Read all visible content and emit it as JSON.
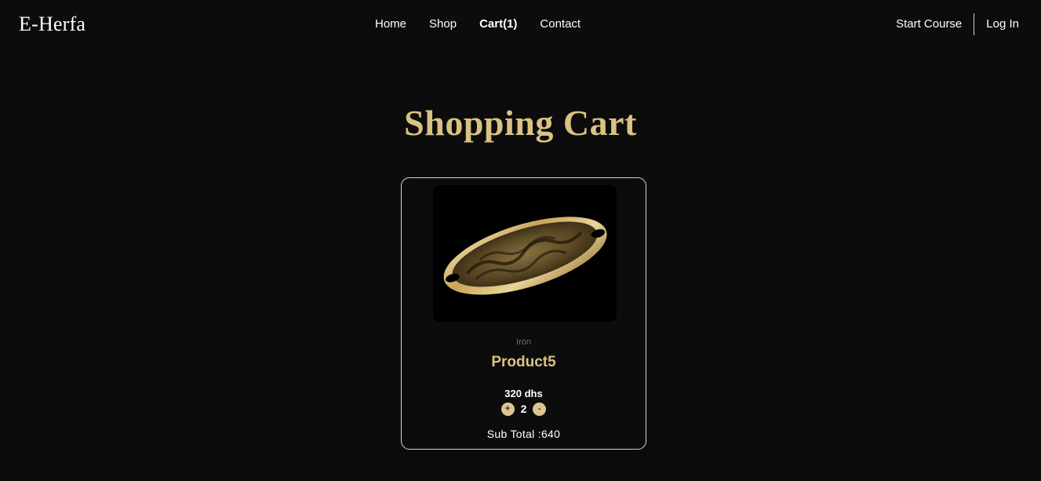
{
  "brand": {
    "logo": "E-Herfa"
  },
  "nav": {
    "links": [
      {
        "label": "Home",
        "active": false
      },
      {
        "label": "Shop",
        "active": false
      },
      {
        "label": "Cart(1)",
        "active": true
      },
      {
        "label": "Contact",
        "active": false
      }
    ],
    "start_course": "Start Course",
    "login": "Log In"
  },
  "page": {
    "title": "Shopping Cart"
  },
  "cart": {
    "item": {
      "image_desc": "product5-tray-image",
      "category": "Iron",
      "name": "Product5",
      "price": "320 dhs",
      "quantity": "2",
      "increment_label": "+",
      "decrement_label": "-",
      "subtotal": "Sub Total :640"
    }
  },
  "colors": {
    "background": "#0c0c0c",
    "accent_gold": "#d9c282",
    "qty_button": "#dcc690",
    "card_border": "#d8d8d8"
  }
}
